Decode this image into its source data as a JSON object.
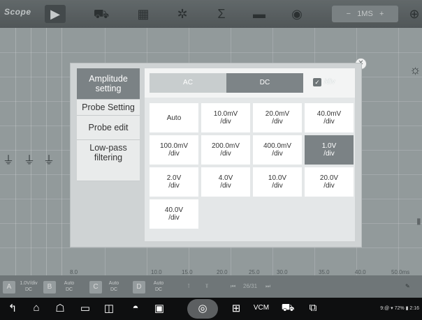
{
  "toolbar": {
    "brand": "Scope",
    "timebase_value": "1MS",
    "timebase_minus": "−",
    "timebase_plus": "+"
  },
  "scope": {
    "x_ticks": [
      "8.0",
      "10.0",
      "15.0",
      "20.0",
      "25.0",
      "30.0",
      "35.0",
      "40.0",
      "50.0ms"
    ]
  },
  "channels": [
    {
      "letter": "A",
      "scale": "1.0V/div",
      "coupling": "DC"
    },
    {
      "letter": "B",
      "scale": "Auto",
      "coupling": "DC"
    },
    {
      "letter": "C",
      "scale": "Auto",
      "coupling": "DC"
    },
    {
      "letter": "D",
      "scale": "Auto",
      "coupling": "DC"
    }
  ],
  "bottom_bar": {
    "page": "26/31"
  },
  "nav": {
    "status": "9:@ ▾ 72% ▮ 2:16"
  },
  "modal": {
    "menu": [
      {
        "label": "Amplitude setting",
        "active": true
      },
      {
        "label": "Probe Setting",
        "active": false
      },
      {
        "label": "Probe edit",
        "active": false
      },
      {
        "label": "Low-pass filtering",
        "active": false
      }
    ],
    "coupling_tabs": [
      "AC",
      "DC"
    ],
    "selected_coupling": "DC",
    "per_div_label": "/div",
    "per_div_checked": true,
    "options": [
      "Auto",
      "10.0mV\n/div",
      "20.0mV\n/div",
      "40.0mV\n/div",
      "100.0mV\n/div",
      "200.0mV\n/div",
      "400.0mV\n/div",
      "1.0V\n/div",
      "2.0V\n/div",
      "4.0V\n/div",
      "10.0V\n/div",
      "20.0V\n/div",
      "40.0V\n/div"
    ],
    "selected_option": "1.0V\n/div"
  },
  "colors": {
    "selected": "#7b8285",
    "toolbar": "#5a6062",
    "navbar": "#0e0f10"
  }
}
